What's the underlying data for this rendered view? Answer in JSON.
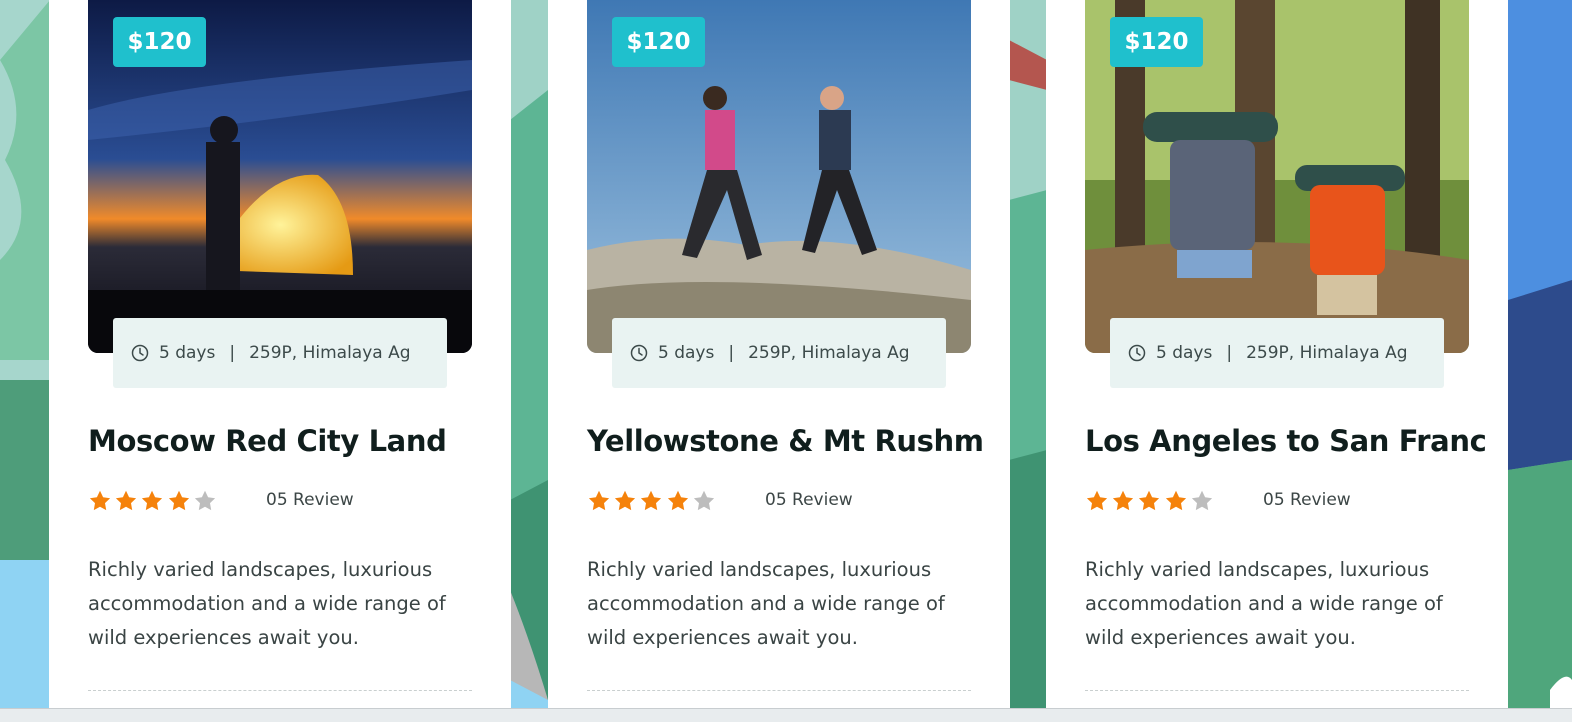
{
  "tours": [
    {
      "price": "$120",
      "duration": "5 days",
      "separator": "|",
      "location": "259P, Himalaya Ag",
      "title": "Moscow Red City Land",
      "rating": 4,
      "max_rating": 5,
      "reviews": "05 Review",
      "description": "Richly varied landscapes, luxurious accommodation and a wide range of wild experiences await you."
    },
    {
      "price": "$120",
      "duration": "5 days",
      "separator": "|",
      "location": "259P, Himalaya Ag",
      "title": "Yellowstone & Mt Rushm",
      "rating": 4,
      "max_rating": 5,
      "reviews": "05 Review",
      "description": "Richly varied landscapes, luxurious accommodation and a wide range of wild experiences await you."
    },
    {
      "price": "$120",
      "duration": "5 days",
      "separator": "|",
      "location": "259P, Himalaya Ag",
      "title": "Los Angeles to San Franc",
      "rating": 4,
      "max_rating": 5,
      "reviews": "05 Review",
      "description": "Richly varied landscapes, luxurious accommodation and a wide range of wild experiences await you."
    }
  ],
  "colors": {
    "accent": "#1fc0cd",
    "star_filled": "#f5820b",
    "star_empty": "#bdbdbd",
    "meta_bg": "#e9f3f2",
    "title": "#101e1d"
  },
  "icons": {
    "meta": "clock-icon",
    "rating": "star-icon"
  }
}
